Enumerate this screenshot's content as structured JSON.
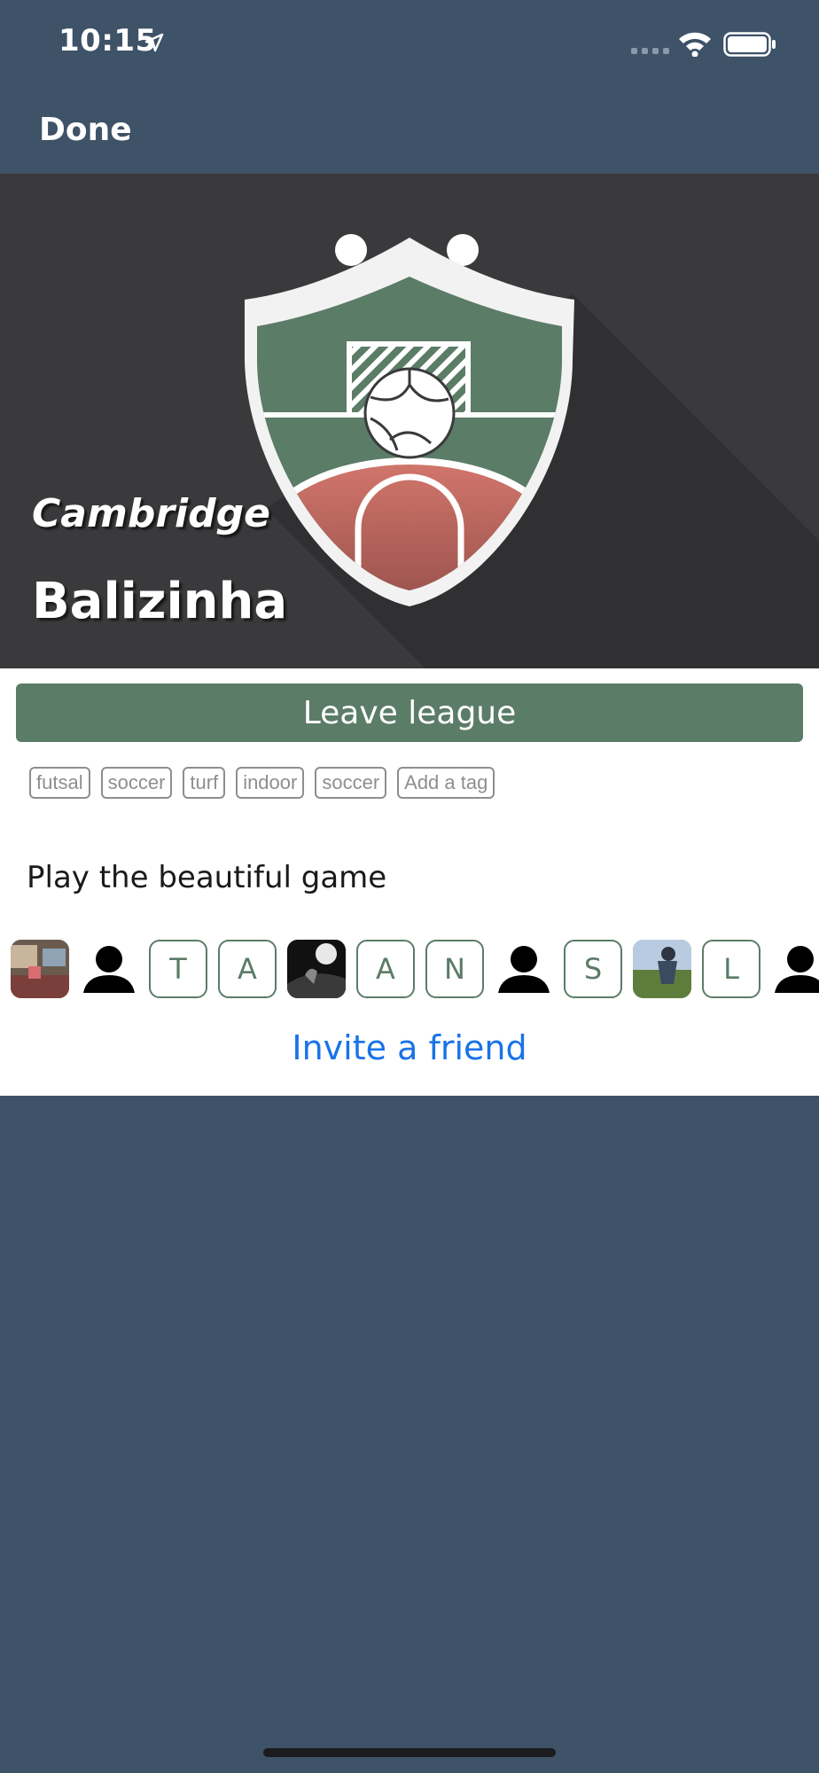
{
  "status_bar": {
    "time": "10:15",
    "icons": [
      "location-arrow-icon",
      "signal-icon",
      "wifi-icon",
      "battery-icon"
    ]
  },
  "nav": {
    "done_label": "Done"
  },
  "league": {
    "subtitle": "Cambridge",
    "title": "Balizinha",
    "leave_label": "Leave league",
    "tags": [
      "futsal",
      "soccer",
      "turf",
      "indoor",
      "soccer"
    ],
    "add_tag_label": "Add a tag",
    "description": "Play the beautiful game",
    "members": [
      {
        "type": "photo",
        "label": ""
      },
      {
        "type": "silhouette",
        "label": ""
      },
      {
        "type": "letter",
        "label": "T"
      },
      {
        "type": "letter",
        "label": "A"
      },
      {
        "type": "photo",
        "label": ""
      },
      {
        "type": "letter",
        "label": "A"
      },
      {
        "type": "letter",
        "label": "N"
      },
      {
        "type": "silhouette",
        "label": ""
      },
      {
        "type": "letter",
        "label": "S"
      },
      {
        "type": "photo",
        "label": ""
      },
      {
        "type": "letter",
        "label": "L"
      },
      {
        "type": "silhouette",
        "label": ""
      }
    ],
    "invite_label": "Invite a friend"
  },
  "colors": {
    "nav_background": "#3e5268",
    "hero_background": "#3a3a3c",
    "accent_green": "#5b7c67",
    "link_blue": "#1a73e8"
  }
}
